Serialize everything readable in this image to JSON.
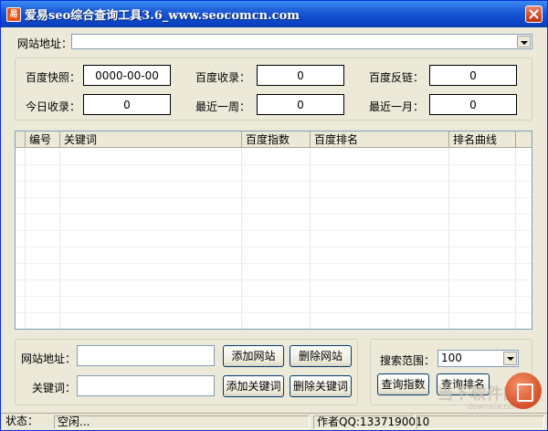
{
  "window": {
    "title": "爱易seo综合查询工具3.6_www.seocomcn.com",
    "icon": "app-icon"
  },
  "url_bar": {
    "label": "网站地址：",
    "value": ""
  },
  "stats": {
    "baidu_snapshot_label": "百度快照：",
    "baidu_snapshot_value": "0000-00-00",
    "baidu_indexed_label": "百度收录：",
    "baidu_indexed_value": "0",
    "baidu_backlinks_label": "百度反链：",
    "baidu_backlinks_value": "0",
    "today_indexed_label": "今日收录：",
    "today_indexed_value": "0",
    "last_week_label": "最近一周：",
    "last_week_value": "0",
    "last_month_label": "最近一月：",
    "last_month_value": "0"
  },
  "table": {
    "columns": [
      "编号",
      "关键词",
      "百度指数",
      "百度排名",
      "排名曲线"
    ],
    "rows": []
  },
  "site_form": {
    "site_label": "网站地址：",
    "site_value": "",
    "keyword_label": "关键词：",
    "keyword_value": "",
    "add_site": "添加网站",
    "delete_site": "删除网站",
    "add_keyword": "添加关键词",
    "delete_keyword": "删除关键词"
  },
  "search_panel": {
    "range_label": "搜索范围：",
    "range_value": "100",
    "query_index": "查询指数",
    "query_rank": "查询排名"
  },
  "statusbar": {
    "status_label": "状态：",
    "status_value": "空闲...",
    "author": "作者QQ:1337190010"
  },
  "watermark": {
    "text": "当下软件园",
    "sub": "downxia.com"
  }
}
